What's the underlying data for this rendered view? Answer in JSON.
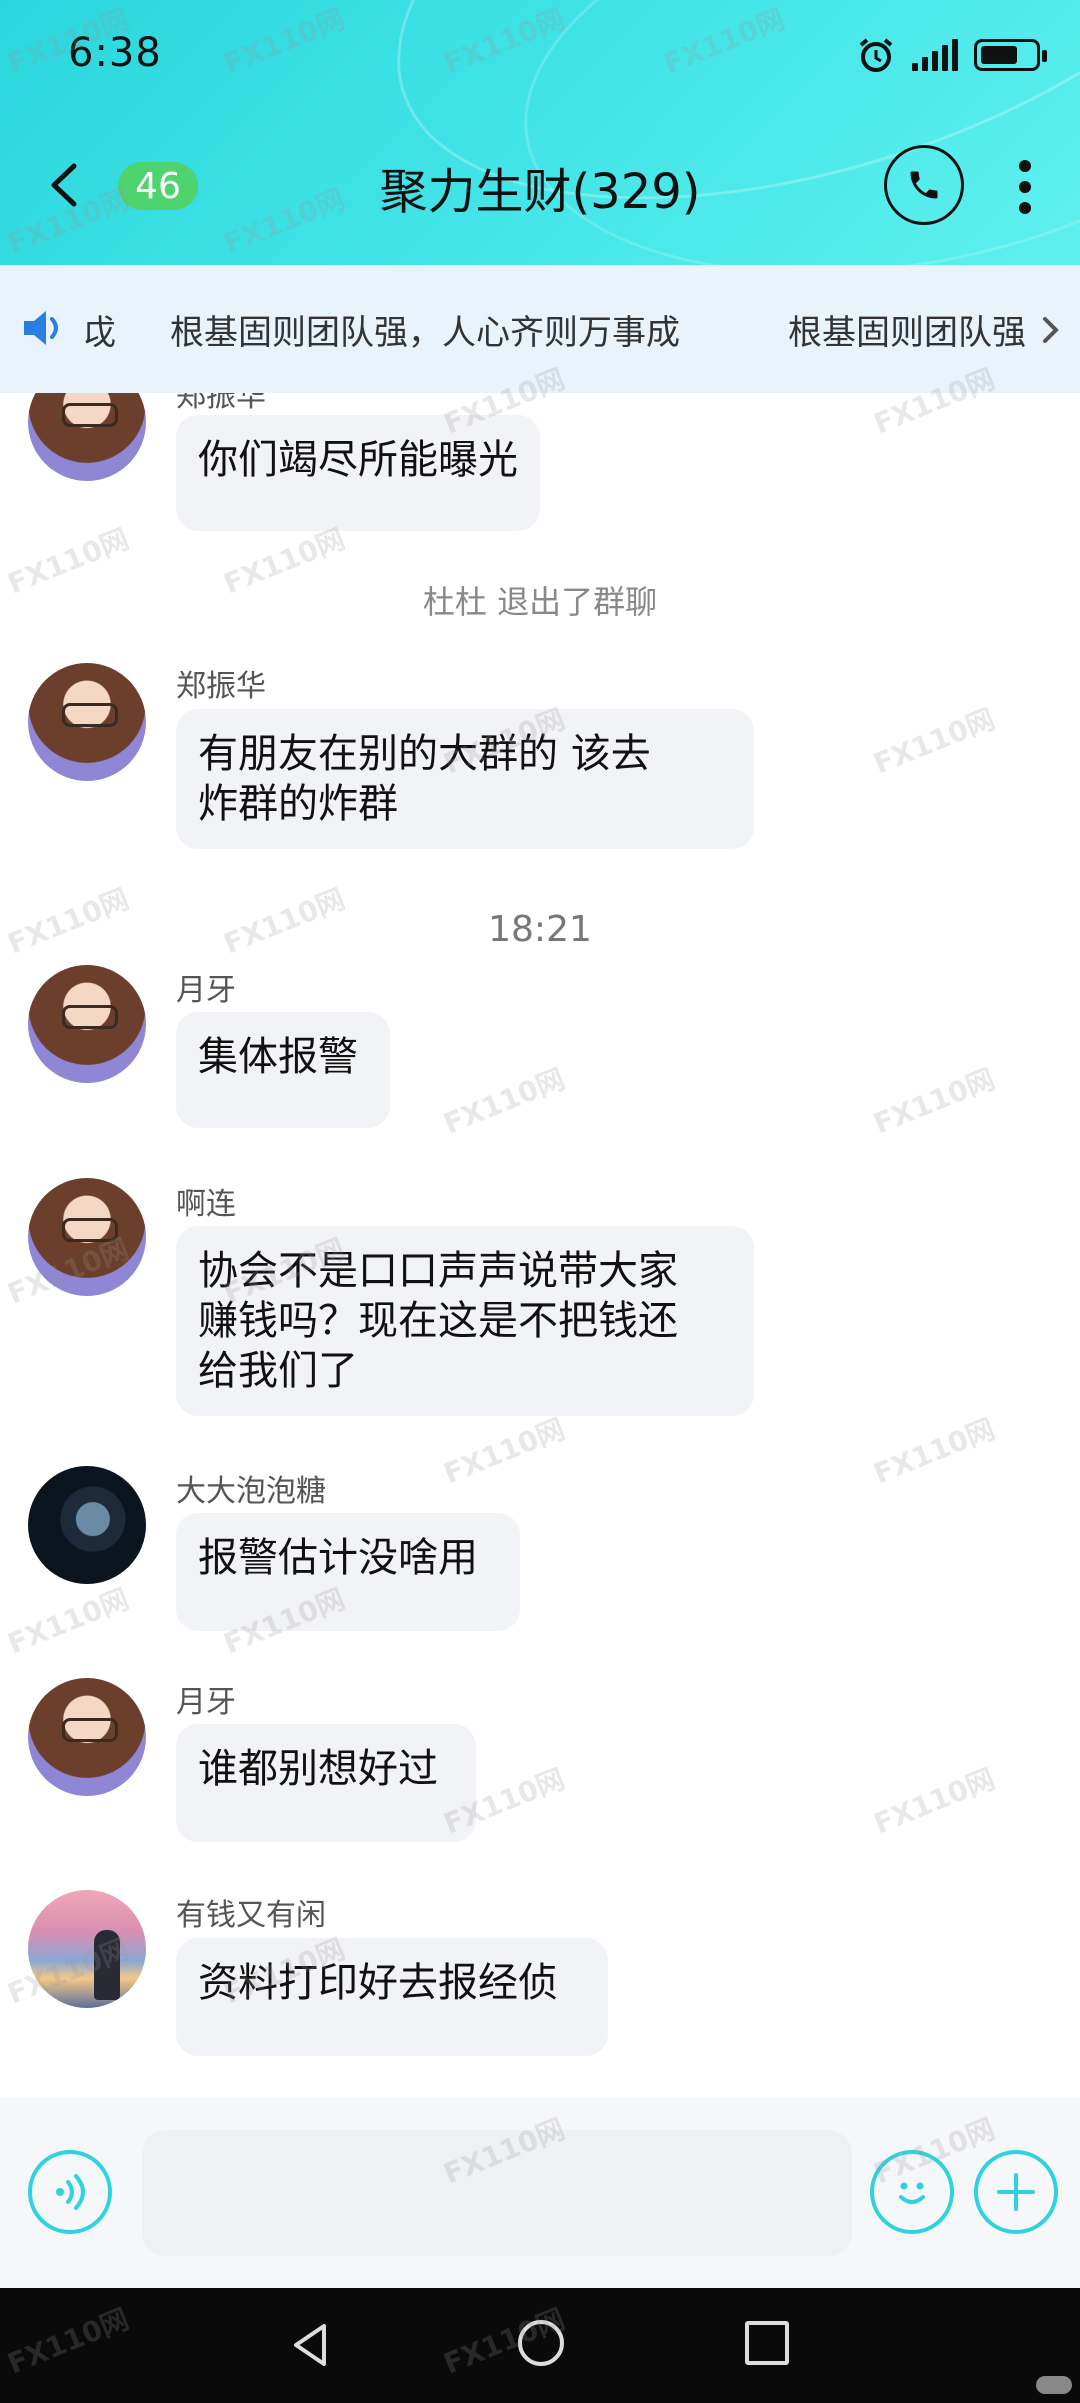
{
  "status_bar": {
    "time": "6:38"
  },
  "header": {
    "unread_count": "46",
    "title": "聚力生财(329)"
  },
  "notice_bar": {
    "fragment": "戉",
    "text": "根基固则团队强，人心齐则万事成",
    "text_repeat": "根基固则团队强"
  },
  "messages": [
    {
      "sender": "郑振华",
      "text": "你们竭尽所能曝光"
    },
    {
      "system": "杜杜 退出了群聊"
    },
    {
      "sender": "郑振华",
      "text_lines": [
        "有朋友在别的大群的  该去",
        "炸群的炸群"
      ]
    },
    {
      "timestamp": "18:21"
    },
    {
      "sender": "月牙",
      "text": "集体报警"
    },
    {
      "sender": "啊连",
      "text_lines": [
        "协会不是口口声声说带大家",
        "赚钱吗？现在这是不把钱还",
        "给我们了"
      ]
    },
    {
      "sender": "大大泡泡糖",
      "text": "报警估计没啥用"
    },
    {
      "sender": "月牙",
      "text": "谁都别想好过"
    },
    {
      "sender": "有钱又有闲",
      "text": "资料打印好去报经侦"
    }
  ],
  "watermark": "FX110网",
  "colors": {
    "header": "#3fe3e6",
    "badge": "#4fd36f",
    "accent": "#2fd3e0",
    "bubble": "#f2f3f6",
    "notice_bg": "#e9f3fb"
  },
  "icons": [
    "back-icon",
    "phone-icon",
    "more-icon",
    "speaker-icon",
    "chevron-right-icon",
    "voice-icon",
    "emoji-icon",
    "plus-icon",
    "nav-back-icon",
    "nav-home-icon",
    "nav-recent-icon"
  ]
}
